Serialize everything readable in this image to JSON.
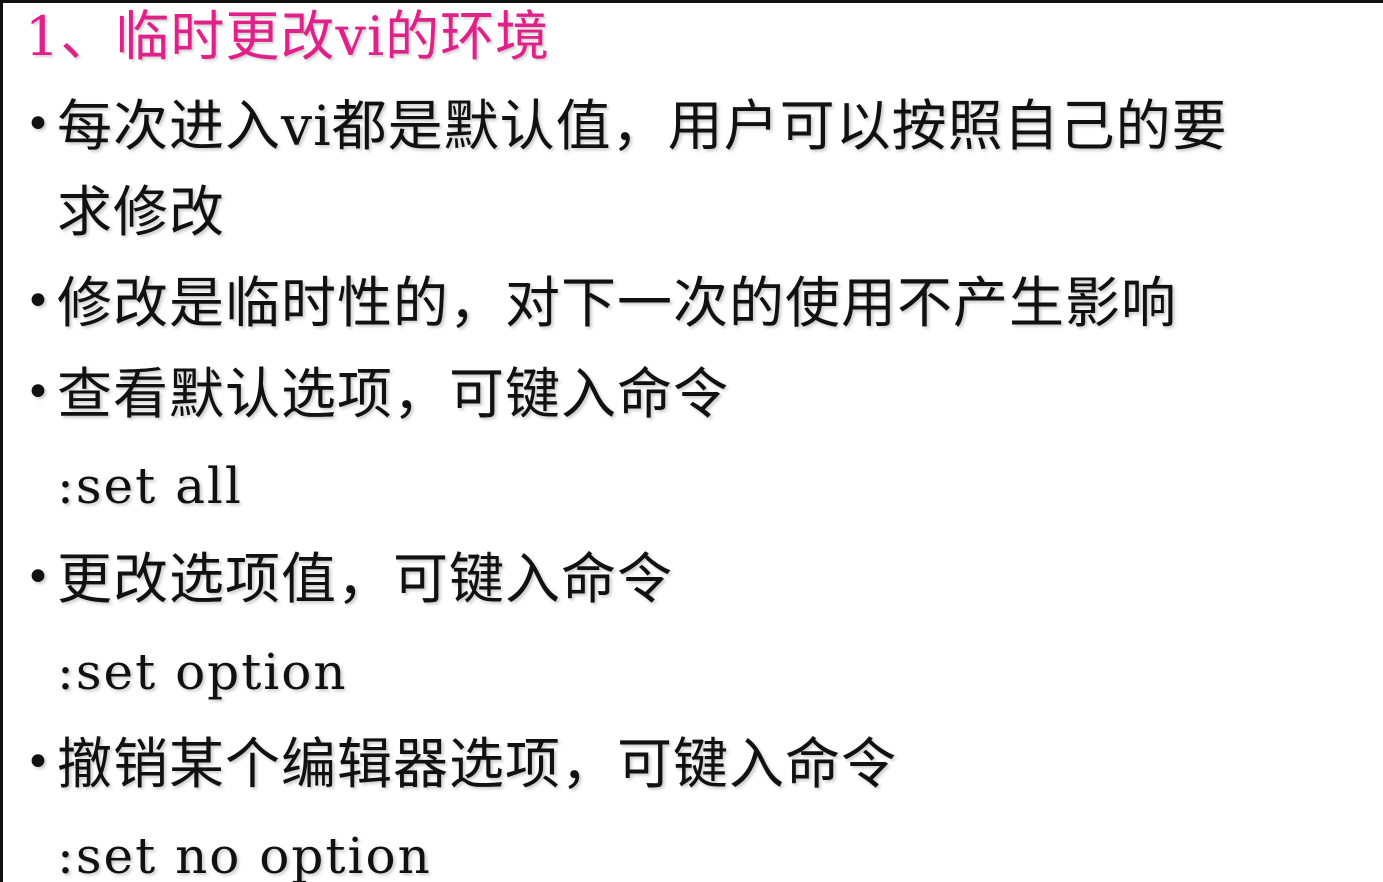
{
  "title": "1、临时更改vi的环境",
  "bullets": {
    "b1_line1": "每次进入vi都是默认值，用户可以按照自己的要",
    "b1_line2": "求修改",
    "b2": "修改是临时性的，对下一次的使用不产生影响",
    "b3": "查看默认选项，可键入命令",
    "b3_cmd": ":set all",
    "b4": "更改选项值，可键入命令",
    "b4_cmd": ":set option",
    "b5": "撤销某个编辑器选项，可键入命令",
    "b5_cmd": ":set no option"
  },
  "bullet_glyph": "•",
  "colors": {
    "title": "#e0218a",
    "text": "#111111",
    "background": "#ffffff",
    "frame": "#111111"
  }
}
